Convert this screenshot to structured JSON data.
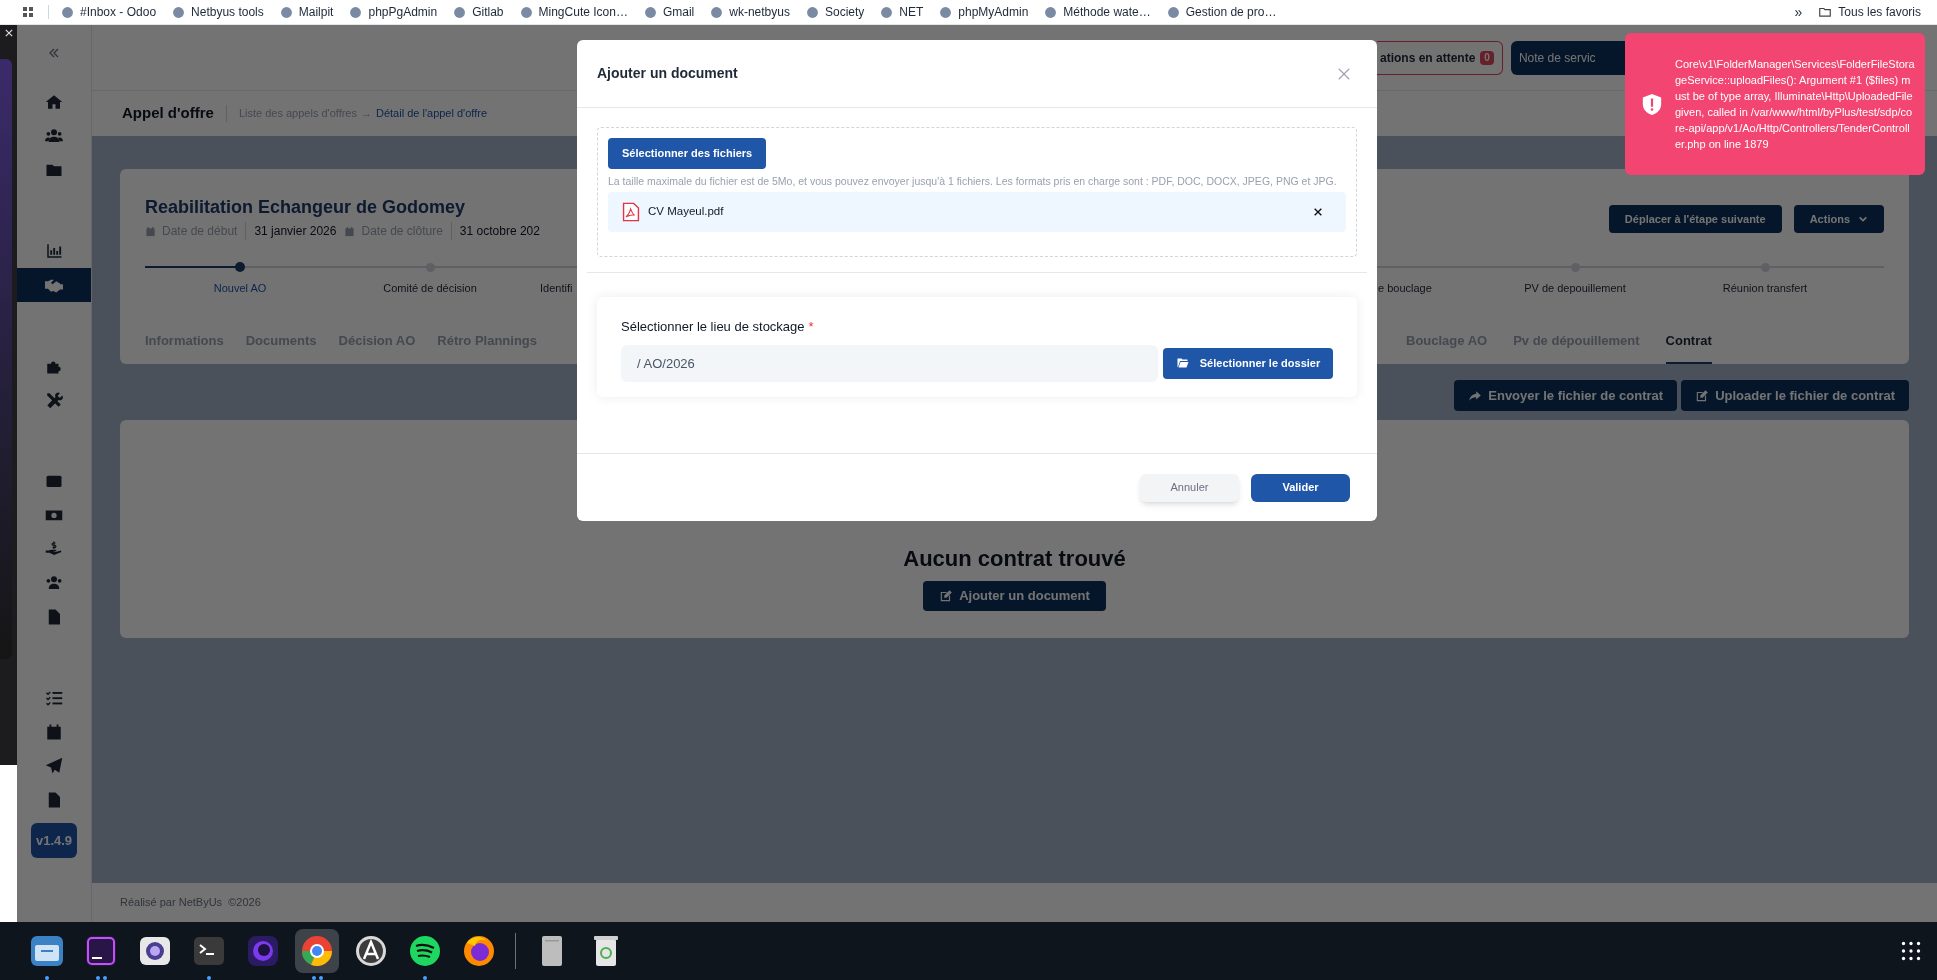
{
  "bookmarks_bar": {
    "items": [
      {
        "label": "#Inbox - Odoo"
      },
      {
        "label": "Netbyus tools"
      },
      {
        "label": "Mailpit"
      },
      {
        "label": "phpPgAdmin"
      },
      {
        "label": "Gitlab"
      },
      {
        "label": "MingCute Icon…"
      },
      {
        "label": "Gmail"
      },
      {
        "label": "wk-netbyus"
      },
      {
        "label": "Society"
      },
      {
        "label": "NET"
      },
      {
        "label": "phpMyAdmin"
      },
      {
        "label": "Méthode wate…"
      },
      {
        "label": "Gestion de pro…"
      }
    ],
    "more": "»",
    "all_bookmarks": "Tous les favoris"
  },
  "sidebar": {
    "groups": [
      {
        "items": [
          {
            "selected": false
          },
          {
            "selected": false
          },
          {
            "selected": false
          }
        ]
      },
      {
        "items": [
          {
            "selected": false
          },
          {
            "selected": true
          }
        ]
      },
      {
        "items": [
          {
            "selected": false
          },
          {
            "selected": false
          }
        ]
      },
      {
        "items": [
          {
            "selected": false
          },
          {
            "selected": false
          },
          {
            "selected": false
          },
          {
            "selected": false
          },
          {
            "selected": false
          }
        ]
      },
      {
        "items": [
          {
            "selected": false
          },
          {
            "selected": false
          },
          {
            "selected": false
          },
          {
            "selected": false
          }
        ]
      }
    ],
    "version": "v1.4.9"
  },
  "header": {
    "pending_button": {
      "label": "ations en attente",
      "badge": "0"
    },
    "note_button": {
      "label": "Note de servic"
    }
  },
  "breadcrumb": {
    "title": "Appel d'offre",
    "items": [
      "Liste des appels d'offres",
      "Détail de l'appel d'offre"
    ],
    "separator": "→"
  },
  "tender": {
    "title": "Reabilitation Echangeur de Godomey",
    "dates": [
      {
        "label": "Date de début",
        "value": "31 janvier 2026"
      },
      {
        "label": "Date de clôture",
        "value": "31 octobre 202"
      }
    ],
    "actions": [
      {
        "label": "Déplacer à l'étape suivante",
        "dropdown": false
      },
      {
        "label": "Actions",
        "dropdown": true
      }
    ],
    "progress": {
      "level": 0.055
    },
    "steps_left": [
      {
        "label": "Nouvel AO",
        "kind": "full",
        "current": true
      },
      {
        "label": "Comité de décision",
        "kind": "full",
        "current": false
      },
      {
        "label": "Identifi",
        "kind": "cut"
      }
    ],
    "steps_right": [
      {
        "label": "e bouclage",
        "kind": "cut"
      },
      {
        "label": "PV de depouillement",
        "kind": "full",
        "current": false
      },
      {
        "label": "Réunion transfert",
        "kind": "full",
        "current": false
      }
    ],
    "tabs_left": [
      {
        "label": "Informations",
        "selected": false
      },
      {
        "label": "Documents",
        "selected": false
      },
      {
        "label": "Décision AO",
        "selected": false
      },
      {
        "label": "Rétro Plannings",
        "selected": false
      }
    ],
    "tabs_right": [
      {
        "label": "Bouclage AO",
        "selected": false
      },
      {
        "label": "Pv de dépouillement",
        "selected": false
      },
      {
        "label": "Contrat",
        "selected": true
      }
    ]
  },
  "contract_buttons": [
    "Envoyer le fichier de contrat",
    "Uploader le fichier de contrat"
  ],
  "empty_state": {
    "message": "Aucun contrat trouvé",
    "button": "Ajouter un document"
  },
  "footer": "Réalisé par NetByUs  ©2026",
  "modal": {
    "title": "Ajouter un document",
    "select_files_button": "Sélectionner des fichiers",
    "help_text": "La taille maximale du fichier est de 5Mo, et vous pouvez envoyer jusqu'à 1 fichiers. Les formats pris en charge sont : PDF, DOC, DOCX, JPEG, PNG et JPG.",
    "files": [
      {
        "name": "CV Mayeul.pdf"
      }
    ],
    "storage": {
      "label": "Sélectionner le lieu de stockage",
      "required_mark": "*",
      "value": "/ AO/2026",
      "button": "Sélectionner le dossier"
    },
    "buttons": [
      {
        "label": "Annuler",
        "kind": "secondary"
      },
      {
        "label": "Valider",
        "kind": "primary"
      }
    ]
  },
  "toast": {
    "message": "Core\\v1\\FolderManager\\Services\\FolderFileStorageService::uploadFiles(): Argument #1 ($files) must be of type array, Illuminate\\Http\\UploadedFile given, called in /var/www/html/byPlus/test/sdp/core-api/app/v1/Ao/Http/Controllers/TenderController.php on line 1879"
  },
  "dock": {
    "items": [
      {
        "running": true,
        "multiple": false,
        "selected": false
      },
      {
        "running": true,
        "multiple": true,
        "selected": false
      },
      {
        "selected": false
      },
      {
        "running": true,
        "multiple": false,
        "selected": false
      },
      {
        "selected": false
      },
      {
        "running": true,
        "multiple": true,
        "selected": true
      },
      {
        "selected": false
      },
      {
        "running": true,
        "multiple": false,
        "selected": false
      },
      {
        "selected": false
      },
      {
        "selected": false
      },
      {
        "selected": false
      }
    ]
  }
}
